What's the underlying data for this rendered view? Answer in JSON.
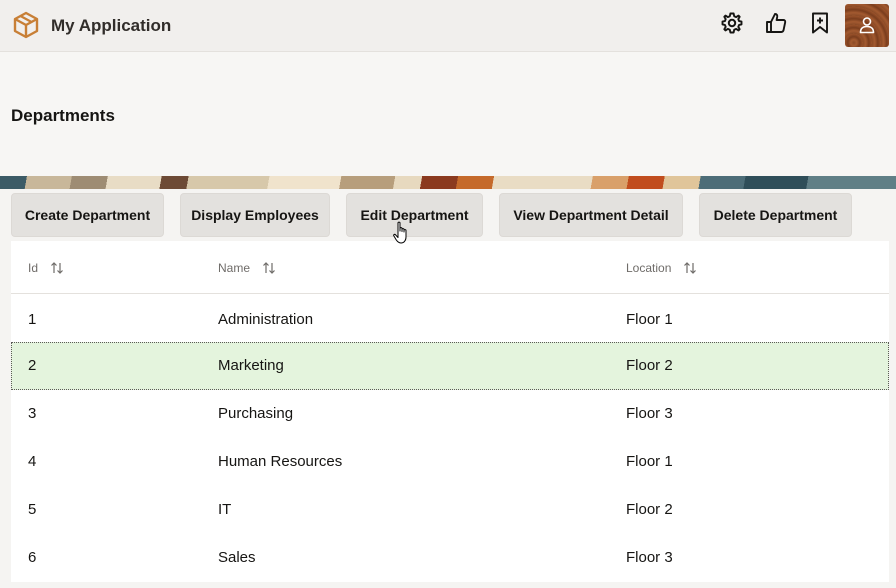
{
  "app": {
    "title": "My Application"
  },
  "toolbar": {
    "icons": [
      "gear-icon",
      "thumbs-up-icon",
      "bookmark-add-icon",
      "user-avatar-icon"
    ]
  },
  "page": {
    "title": "Departments"
  },
  "actions": [
    {
      "label": "Create Department"
    },
    {
      "label": "Display Employees"
    },
    {
      "label": "Edit Department"
    },
    {
      "label": "View Department Detail"
    },
    {
      "label": "Delete Department"
    }
  ],
  "table": {
    "columns": [
      {
        "label": "Id"
      },
      {
        "label": "Name"
      },
      {
        "label": "Location"
      }
    ],
    "rows": [
      {
        "id": "1",
        "name": "Administration",
        "location": "Floor 1"
      },
      {
        "id": "2",
        "name": "Marketing",
        "location": "Floor 2"
      },
      {
        "id": "3",
        "name": "Purchasing",
        "location": "Floor 3"
      },
      {
        "id": "4",
        "name": "Human Resources",
        "location": "Floor 1"
      },
      {
        "id": "5",
        "name": "IT",
        "location": "Floor 2"
      },
      {
        "id": "6",
        "name": "Sales",
        "location": "Floor 3"
      }
    ],
    "selected_row_id": "2"
  },
  "colors": {
    "brand": "#c87f36",
    "selected_row": "#e4f4dd",
    "button_bg": "#e3e1de"
  }
}
